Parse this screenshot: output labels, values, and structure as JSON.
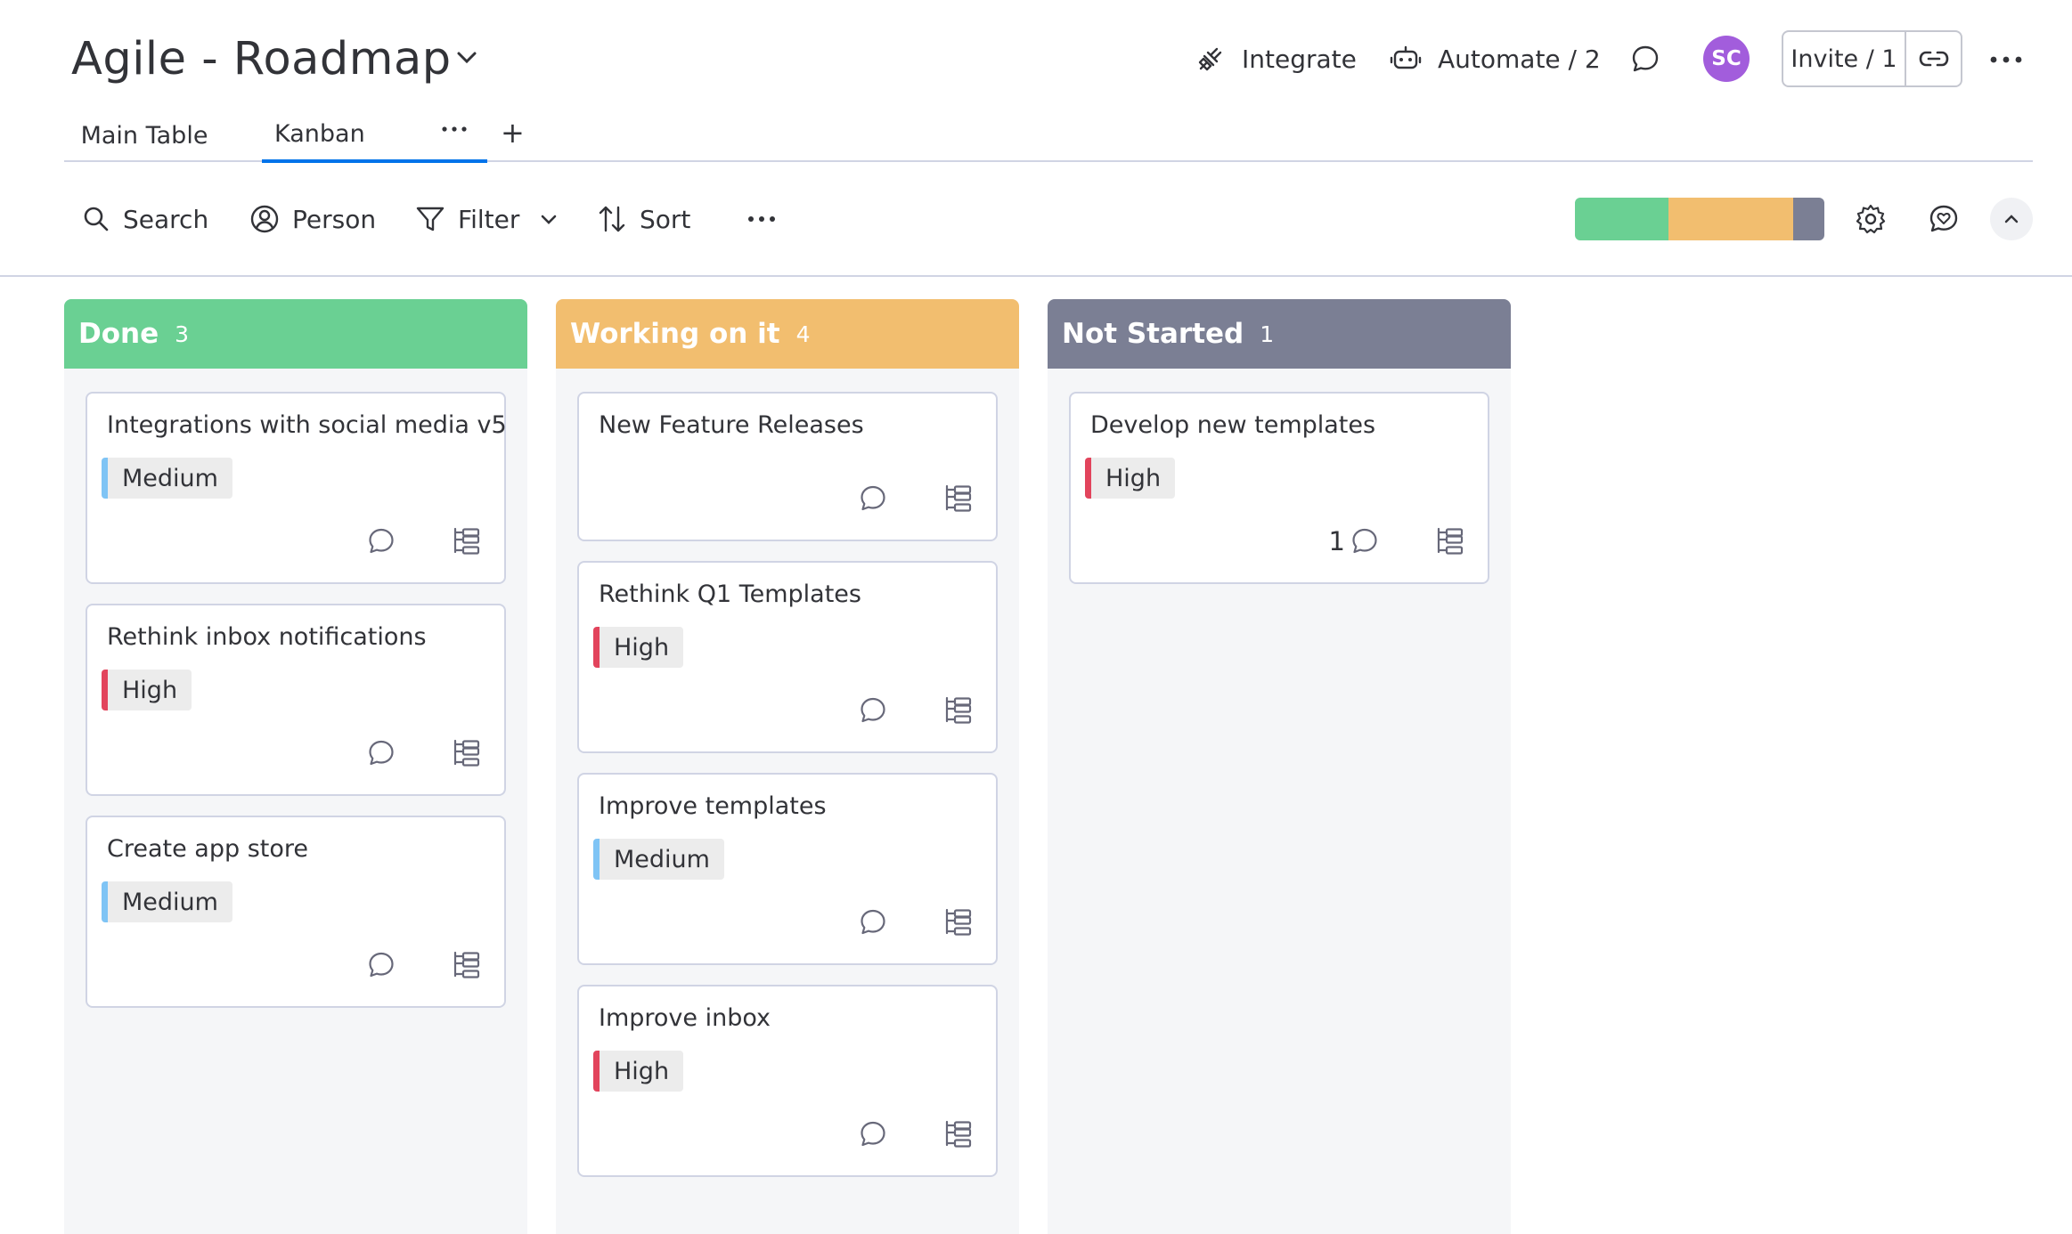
{
  "board": {
    "title": "Agile - Roadmap"
  },
  "header_actions": {
    "integrate": "Integrate",
    "automate": "Automate / 2",
    "avatar_initials": "SC",
    "invite": "Invite / 1"
  },
  "views": {
    "tabs": [
      {
        "label": "Main Table"
      },
      {
        "label": "Kanban"
      }
    ],
    "add": "+"
  },
  "toolbar": {
    "search": "Search",
    "person": "Person",
    "filter": "Filter",
    "sort": "Sort"
  },
  "status_summary": [
    {
      "color": "#6ad093",
      "fraction": 0.375
    },
    {
      "color": "#f2be6f",
      "fraction": 0.5
    },
    {
      "color": "#7b7f94",
      "fraction": 0.125
    }
  ],
  "colors": {
    "done": "#6ad093",
    "working": "#f2be6f",
    "not_started": "#7b7f94",
    "high": "#e2445c",
    "medium": "#7fc4f5",
    "accent": "#0073ea"
  },
  "columns": [
    {
      "title": "Done",
      "count": "3",
      "cards": [
        {
          "title": "Integrations with social media v5",
          "priority": "Medium",
          "comments": ""
        },
        {
          "title": "Rethink inbox notifications",
          "priority": "High",
          "comments": ""
        },
        {
          "title": "Create app store",
          "priority": "Medium",
          "comments": ""
        }
      ]
    },
    {
      "title": "Working on it",
      "count": "4",
      "cards": [
        {
          "title": "New Feature Releases",
          "priority": "",
          "comments": ""
        },
        {
          "title": "Rethink Q1 Templates",
          "priority": "High",
          "comments": ""
        },
        {
          "title": "Improve templates",
          "priority": "Medium",
          "comments": ""
        },
        {
          "title": "Improve inbox",
          "priority": "High",
          "comments": ""
        }
      ]
    },
    {
      "title": "Not Started",
      "count": "1",
      "cards": [
        {
          "title": "Develop new templates",
          "priority": "High",
          "comments": "1"
        }
      ]
    }
  ]
}
